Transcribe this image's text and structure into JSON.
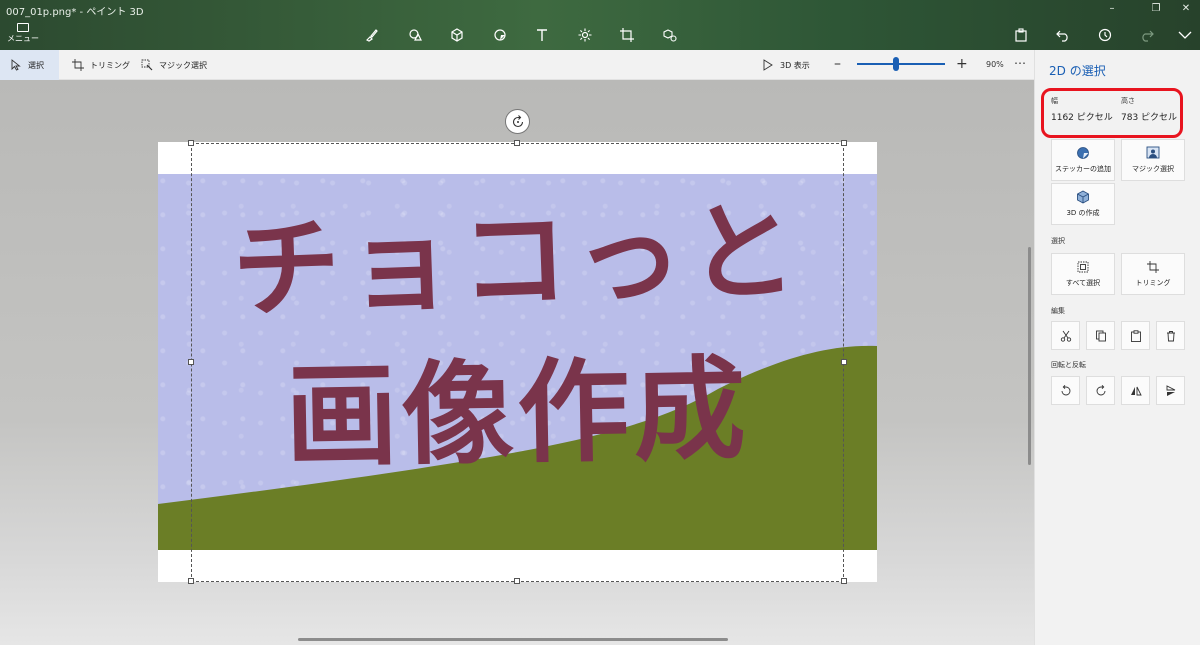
{
  "window": {
    "title": "007_01p.png* - ペイント 3D",
    "controls": [
      "minimize-icon",
      "restore-icon",
      "close-icon"
    ]
  },
  "menu": {
    "label": "メニュー",
    "icon": "folder-icon"
  },
  "toolbar_tools": [
    {
      "name": "brushes-tool",
      "icon": "brush-icon"
    },
    {
      "name": "2d-shapes-tool",
      "icon": "2d-shapes-icon"
    },
    {
      "name": "3d-shapes-tool",
      "icon": "cube-icon"
    },
    {
      "name": "stickers-tool",
      "icon": "sticker-icon"
    },
    {
      "name": "text-tool",
      "icon": "text-icon"
    },
    {
      "name": "effects-tool",
      "icon": "sun-icon"
    },
    {
      "name": "canvas-tool",
      "icon": "crop-icon"
    },
    {
      "name": "3d-library-tool",
      "icon": "library-icon"
    }
  ],
  "toolbar_right": [
    {
      "name": "paste-button",
      "icon": "clipboard-icon"
    },
    {
      "name": "undo-button",
      "icon": "undo-icon"
    },
    {
      "name": "history-button",
      "icon": "history-icon"
    },
    {
      "name": "redo-button",
      "icon": "redo-icon"
    },
    {
      "name": "expand-button",
      "icon": "chevron-down-icon"
    }
  ],
  "commandbar": {
    "select_label": "選択",
    "trim_label": "トリミング",
    "magic_select_label": "マジック選択",
    "view3d_label": "3D 表示",
    "zoom_value": "90%",
    "zoom_fraction": 0.45
  },
  "canvas": {
    "line1": "チョコっと",
    "line2": "画像作成",
    "colors": {
      "sky": "#b9bde9",
      "hill": "#6b7e26",
      "text": "#7a344b"
    }
  },
  "panel": {
    "title": "2D の選択",
    "width_label": "幅",
    "width_value": "1162 ピクセル",
    "height_label": "高さ",
    "height_value": "783 ピクセル",
    "buttons_top": {
      "add_sticker": "ステッカーの追加",
      "magic_select": "マジック選択",
      "make_3d": "3D の作成"
    },
    "select_section": "選択",
    "select_all": "すべて選択",
    "trim": "トリミング",
    "edit_section": "編集",
    "rotate_section": "回転と反転"
  },
  "accent_color": "#1a5fb4",
  "highlight_color": "#e8141f"
}
